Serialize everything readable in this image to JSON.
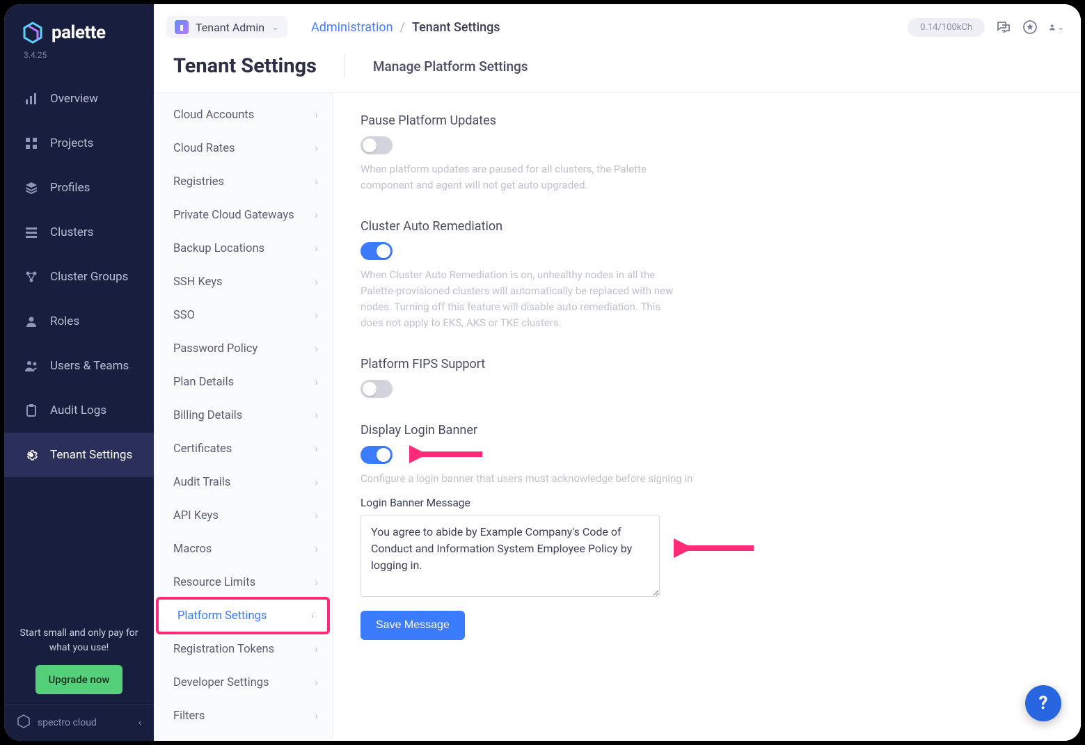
{
  "brand": {
    "name": "palette",
    "version": "3.4.25",
    "footer_brand": "spectro cloud"
  },
  "sidebar": {
    "items": [
      {
        "label": "Overview"
      },
      {
        "label": "Projects"
      },
      {
        "label": "Profiles"
      },
      {
        "label": "Clusters"
      },
      {
        "label": "Cluster Groups"
      },
      {
        "label": "Roles"
      },
      {
        "label": "Users & Teams"
      },
      {
        "label": "Audit Logs"
      },
      {
        "label": "Tenant Settings"
      }
    ],
    "footer_text": "Start small and only pay for what you use!",
    "upgrade_label": "Upgrade now"
  },
  "topbar": {
    "scope_label": "Tenant Admin",
    "breadcrumb_admin": "Administration",
    "breadcrumb_current": "Tenant Settings",
    "usage": "0.14/100kCh"
  },
  "header": {
    "title": "Tenant Settings",
    "subtitle": "Manage Platform Settings"
  },
  "settings_menu": [
    "Cloud Accounts",
    "Cloud Rates",
    "Registries",
    "Private Cloud Gateways",
    "Backup Locations",
    "SSH Keys",
    "SSO",
    "Password Policy",
    "Plan Details",
    "Billing Details",
    "Certificates",
    "Audit Trails",
    "API Keys",
    "Macros",
    "Resource Limits",
    "Platform Settings",
    "Registration Tokens",
    "Developer Settings",
    "Filters"
  ],
  "settings_selected_index": 15,
  "platform": {
    "pause_title": "Pause Platform Updates",
    "pause_desc": "When platform updates are paused for all clusters, the Palette component and agent will not get auto upgraded.",
    "auto_title": "Cluster Auto Remediation",
    "auto_desc": "When Cluster Auto Remediation is on, unhealthy nodes in all the Palette-provisioned clusters will automatically be replaced with new nodes. Turning off this feature will disable auto remediation. This does not apply to EKS, AKS or TKE clusters.",
    "fips_title": "Platform FIPS Support",
    "banner_title": "Display Login Banner",
    "banner_desc": "Configure a login banner that users must acknowledge before signing in",
    "banner_field_label": "Login Banner Message",
    "banner_value": "You agree to abide by Example Company's Code of Conduct and Information System Employee Policy by logging in.",
    "save_label": "Save Message"
  },
  "help_glyph": "?"
}
